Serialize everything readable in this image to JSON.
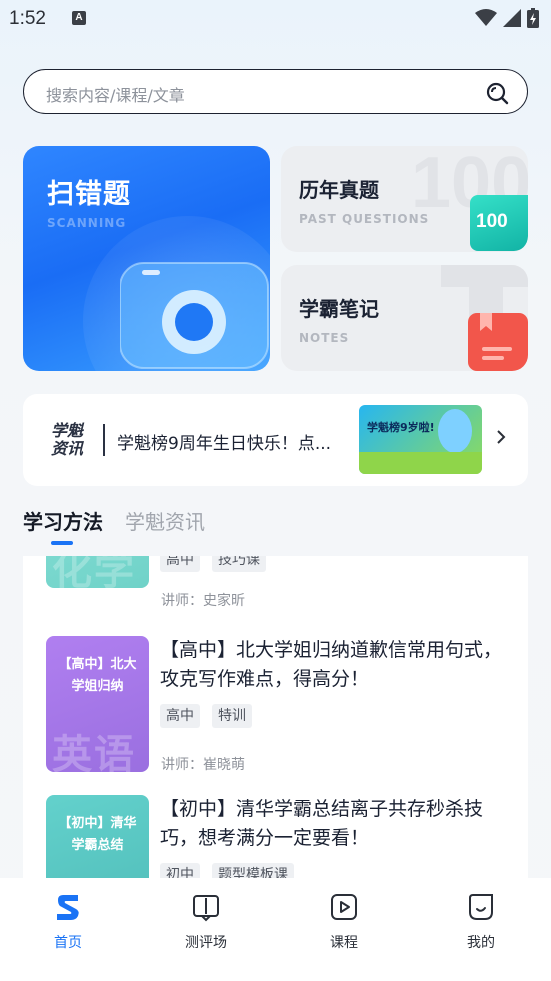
{
  "status_bar": {
    "time": "1:52",
    "notification_icon": "A"
  },
  "search": {
    "placeholder": "搜索内容/课程/文章"
  },
  "cards": {
    "scan": {
      "title": "扫错题",
      "subtitle": "SCANNING"
    },
    "past": {
      "title": "历年真题",
      "subtitle": "PAST QUESTIONS",
      "badge": "100",
      "watermark": "100"
    },
    "notes": {
      "title": "学霸笔记",
      "subtitle": "NOTES"
    }
  },
  "news": {
    "logo_line1": "学魁",
    "logo_line2": "资讯",
    "text": "学魁榜9周年生日快乐！点...",
    "thumb_text": "学魁榜9岁啦!"
  },
  "tabs": [
    {
      "label": "学习方法",
      "active": true
    },
    {
      "label": "学魁资讯",
      "active": false
    }
  ],
  "courses": [
    {
      "thumb_title": "",
      "thumb_word": "化学",
      "title": "",
      "tags": [
        "高中",
        "技巧课"
      ],
      "teacher": "讲师：史家昕",
      "color": "#7fd9d0"
    },
    {
      "thumb_title": "【高中】北大学姐归纳",
      "thumb_word": "英语",
      "title": "【高中】北大学姐归纳道歉信常用句式，攻克写作难点，得高分！",
      "tags": [
        "高中",
        "特训"
      ],
      "teacher": "讲师：崔晓萌",
      "color": "#a77ee6"
    },
    {
      "thumb_title": "【初中】清华学霸总结",
      "thumb_word": "",
      "title": "【初中】清华学霸总结离子共存秒杀技巧，想考满分一定要看！",
      "tags": [
        "初中",
        "题型模板课"
      ],
      "teacher": "",
      "color": "#5bc7c3"
    }
  ],
  "bottom_nav": [
    {
      "label": "首页",
      "icon": "home-logo-icon",
      "active": true
    },
    {
      "label": "测评场",
      "icon": "book-icon",
      "active": false
    },
    {
      "label": "课程",
      "icon": "play-icon",
      "active": false
    },
    {
      "label": "我的",
      "icon": "smile-icon",
      "active": false
    }
  ],
  "colors": {
    "accent": "#1a73f5",
    "text": "#1b2233",
    "muted": "#8e929a"
  }
}
